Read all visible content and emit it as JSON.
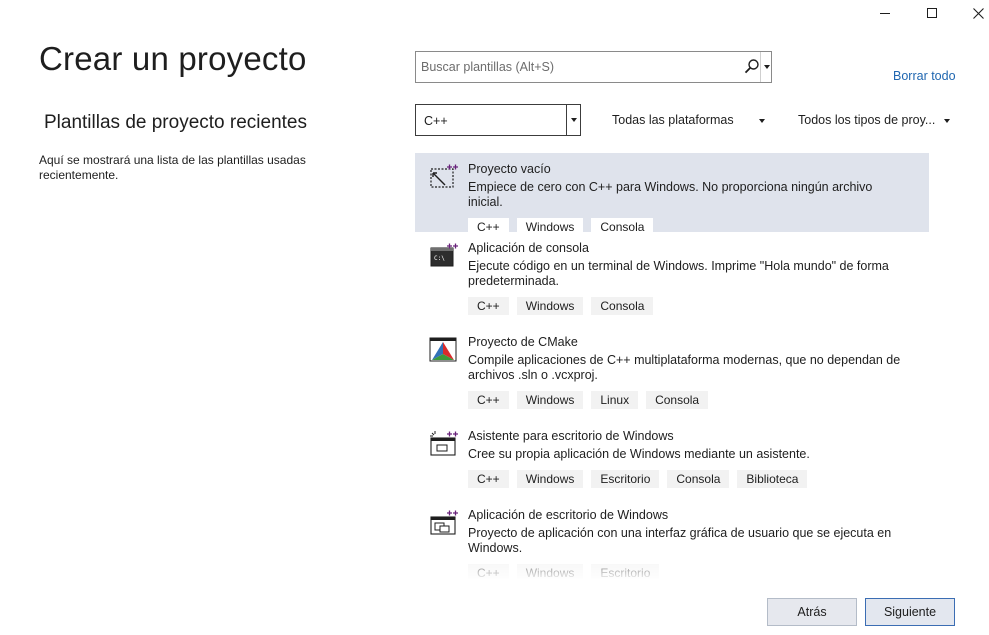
{
  "window": {
    "minimize_glyph": "—",
    "maximize_glyph": "☐",
    "close_glyph": "✕"
  },
  "page": {
    "title": "Crear un proyecto",
    "recent_title": "Plantillas de proyecto recientes",
    "recent_desc": "Aquí se mostrará una lista de las plantillas usadas recientemente."
  },
  "search": {
    "placeholder": "Buscar plantillas (Alt+S)",
    "value": ""
  },
  "clear_all_label": "Borrar todo",
  "filters": {
    "language": "C++",
    "platform": "Todas las plataformas",
    "project_type": "Todos los tipos de proy..."
  },
  "templates": [
    {
      "name": "Proyecto vacío",
      "desc": "Empiece de cero con C++ para Windows. No proporciona ningún archivo inicial.",
      "tags": [
        "C++",
        "Windows",
        "Consola"
      ],
      "icon": "empty-project-icon"
    },
    {
      "name": "Aplicación de consola",
      "desc": "Ejecute código en un terminal de Windows. Imprime \"Hola mundo\" de forma predeterminada.",
      "tags": [
        "C++",
        "Windows",
        "Consola"
      ],
      "icon": "console-app-icon"
    },
    {
      "name": "Proyecto de CMake",
      "desc": "Compile aplicaciones de C++ multiplataforma modernas, que no dependan de archivos .sln o .vcxproj.",
      "tags": [
        "C++",
        "Windows",
        "Linux",
        "Consola"
      ],
      "icon": "cmake-icon"
    },
    {
      "name": "Asistente para escritorio de Windows",
      "desc": "Cree su propia aplicación de Windows mediante un asistente.",
      "tags": [
        "C++",
        "Windows",
        "Escritorio",
        "Consola",
        "Biblioteca"
      ],
      "icon": "desktop-wizard-icon"
    },
    {
      "name": "Aplicación de escritorio de Windows",
      "desc": "Proyecto de aplicación con una interfaz gráfica de usuario que se ejecuta en Windows.",
      "tags": [
        "C++",
        "Windows",
        "Escritorio"
      ],
      "icon": "desktop-app-icon"
    }
  ],
  "buttons": {
    "back": "Atrás",
    "next": "Siguiente"
  },
  "colors": {
    "selected_bg": "#dfe3ec",
    "link": "#1f66b0",
    "accent_plus": "#68217a"
  }
}
